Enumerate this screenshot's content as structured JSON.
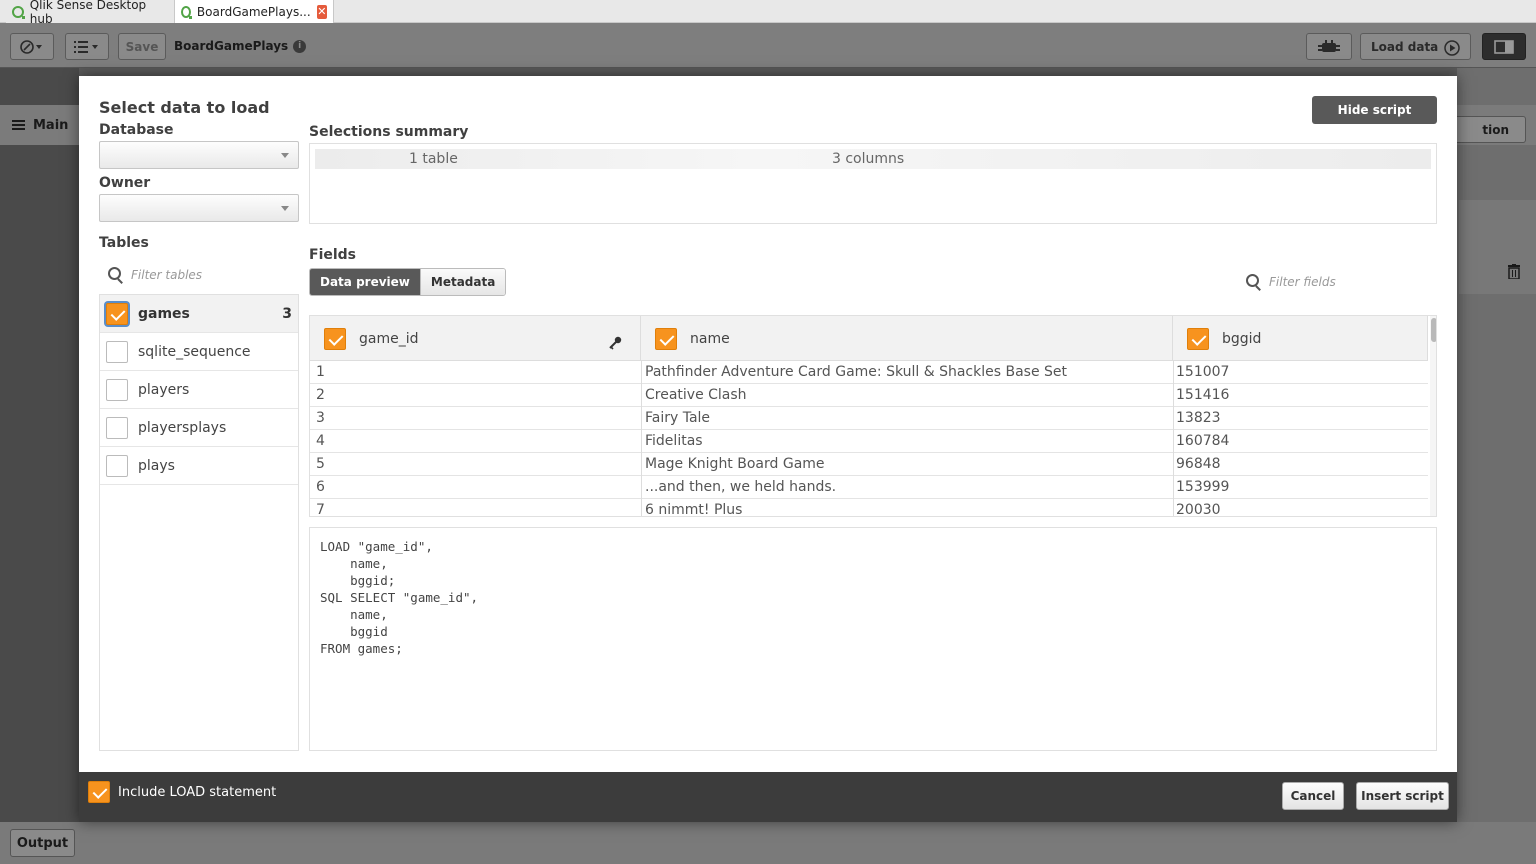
{
  "browser": {
    "tabs": [
      {
        "label": "Qlik Sense Desktop hub"
      },
      {
        "label": "BoardGamePlays..."
      }
    ],
    "close_glyph": "✕"
  },
  "toolbar": {
    "save_label": "Save",
    "app_title": "BoardGamePlays",
    "info_glyph": "i",
    "load_data_label": "Load data"
  },
  "background": {
    "main_label": "Main",
    "right_button_label": "tion",
    "output_label": "Output"
  },
  "dialog": {
    "title": "Select data to load",
    "hide_script_label": "Hide script",
    "database_label": "Database",
    "owner_label": "Owner",
    "tables_label": "Tables",
    "filter_tables_placeholder": "Filter tables",
    "tables": [
      {
        "name": "games",
        "checked": true,
        "count": "3"
      },
      {
        "name": "sqlite_sequence",
        "checked": false
      },
      {
        "name": "players",
        "checked": false
      },
      {
        "name": "playersplays",
        "checked": false
      },
      {
        "name": "plays",
        "checked": false
      }
    ],
    "summary_label": "Selections summary",
    "summary": {
      "tables": "1 table",
      "columns": "3 columns"
    },
    "fields_label": "Fields",
    "view_tabs": {
      "data_preview": "Data preview",
      "metadata": "Metadata"
    },
    "filter_fields_placeholder": "Filter fields",
    "columns": [
      "game_id",
      "name",
      "bggid"
    ],
    "rows": [
      [
        "1",
        "Pathfinder Adventure Card Game: Skull & Shackles Base Set",
        "151007"
      ],
      [
        "2",
        "Creative Clash",
        "151416"
      ],
      [
        "3",
        "Fairy Tale",
        "13823"
      ],
      [
        "4",
        "Fidelitas",
        "160784"
      ],
      [
        "5",
        "Mage Knight Board Game",
        "96848"
      ],
      [
        "6",
        "...and then, we held hands.",
        "153999"
      ],
      [
        "7",
        "6 nimmt! Plus",
        "20030"
      ]
    ],
    "script": "LOAD \"game_id\",\n    name,\n    bggid;\nSQL SELECT \"game_id\",\n    name,\n    bggid\nFROM games;",
    "include_load_label": "Include LOAD statement",
    "cancel_label": "Cancel",
    "insert_script_label": "Insert script"
  },
  "colors": {
    "accent": "#f7931e",
    "dark_button": "#595959",
    "qlik_green": "#52a447",
    "close_red": "#e55b3c"
  }
}
